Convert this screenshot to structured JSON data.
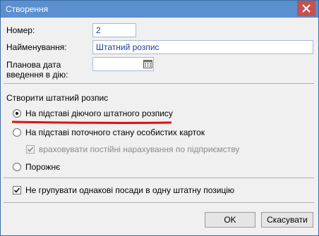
{
  "window": {
    "title": "Створення"
  },
  "fields": {
    "number_label": "Номер:",
    "number_value": "2",
    "name_label": "Найменування:",
    "name_value": "Штатний розпис",
    "date_label_line1": "Планова дата",
    "date_label_line2": "введення в дію:",
    "date_value": ""
  },
  "create_section": {
    "heading": "Створити штатний розпис",
    "options": [
      {
        "label": "На підставі діючого штатного розпису",
        "selected": true
      },
      {
        "label": "На підставі поточного стану особистих карток",
        "selected": false
      },
      {
        "label": "Порожнє",
        "selected": false
      }
    ],
    "sub_option": {
      "label": "враховувати постійні нарахування по підприємству",
      "checked": true,
      "enabled": false
    }
  },
  "no_group_option": {
    "label": "Не групувати однакові посади в одну штатну позицію",
    "checked": true
  },
  "buttons": {
    "ok": "OK",
    "cancel": "Скасувати"
  },
  "colors": {
    "titlebar": "#5a8fd0",
    "close": "#c75050",
    "annotation": "#e01010"
  },
  "icons": {
    "close": "close-icon",
    "calendar": "calendar-icon"
  }
}
